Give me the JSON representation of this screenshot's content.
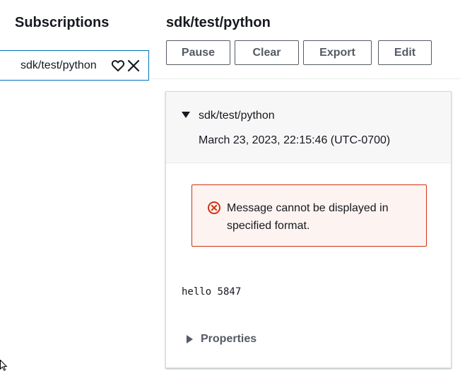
{
  "sidebar": {
    "title": "Subscriptions",
    "items": [
      {
        "label": "sdk/test/python",
        "favorite_icon": "heart-outline-icon",
        "close_icon": "close-icon"
      }
    ]
  },
  "header": {
    "title": "sdk/test/python",
    "buttons": {
      "pause": "Pause",
      "clear": "Clear",
      "export": "Export",
      "edit": "Edit"
    }
  },
  "message": {
    "topic": "sdk/test/python",
    "timestamp": "March 23, 2023, 22:15:46 (UTC-0700)",
    "error": "Message cannot be displayed in specified format.",
    "payload": "hello 5847",
    "properties_label": "Properties"
  },
  "colors": {
    "accent_border": "#0073bb",
    "error_border": "#d13212",
    "error_bg": "#fdf3f1",
    "button_text": "#545b64"
  }
}
